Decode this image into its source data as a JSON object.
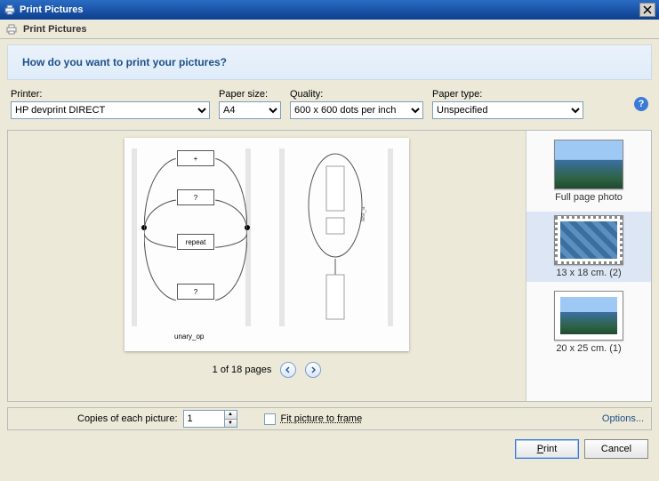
{
  "window": {
    "title": "Print Pictures"
  },
  "subheader": {
    "title": "Print Pictures"
  },
  "banner": {
    "question": "How do you want to print your pictures?"
  },
  "fields": {
    "printer": {
      "label": "Printer:",
      "value": "HP devprint DIRECT"
    },
    "paper_size": {
      "label": "Paper size:",
      "value": "A4"
    },
    "quality": {
      "label": "Quality:",
      "value": "600 x 600 dots per inch"
    },
    "paper_type": {
      "label": "Paper type:",
      "value": "Unspecified"
    }
  },
  "preview": {
    "diagram_box1": "+",
    "diagram_box2": "?",
    "diagram_box3": "repeat",
    "diagram_box4": "?",
    "diagram_label": "unary_op",
    "pager_text": "1 of 18 pages"
  },
  "layouts": {
    "i0": "Full page photo",
    "i1": "13 x 18 cm. (2)",
    "i2": "20 x 25 cm. (1)"
  },
  "copies": {
    "label": "Copies of each picture:",
    "value": "1",
    "fit_label": "Fit picture to frame"
  },
  "options_link": "Options...",
  "buttons": {
    "print": "Print",
    "cancel": "Cancel"
  }
}
